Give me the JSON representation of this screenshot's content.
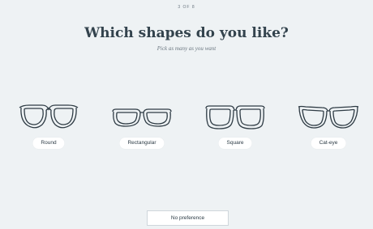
{
  "step": "3 OF 8",
  "title": "Which shapes do you like?",
  "subtitle": "Pick as many as you want",
  "shapes": [
    {
      "label": "Round"
    },
    {
      "label": "Rectangular"
    },
    {
      "label": "Square"
    },
    {
      "label": "Cat-eye"
    }
  ],
  "no_preference_label": "No preference"
}
